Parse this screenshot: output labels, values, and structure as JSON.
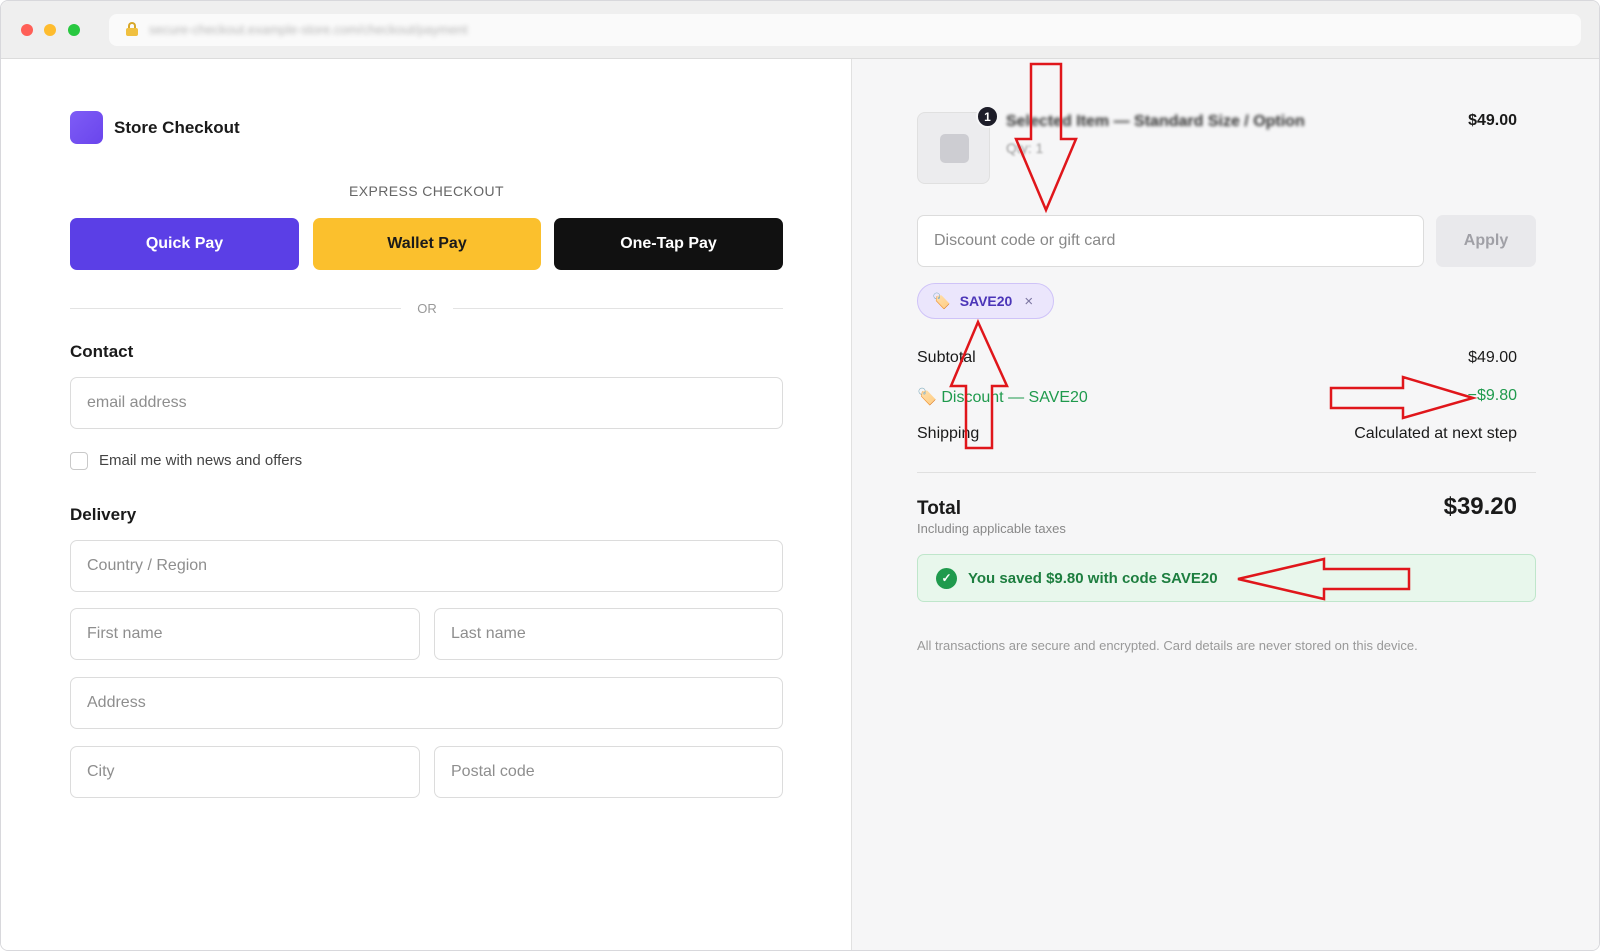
{
  "browser": {
    "url": "secure-checkout.example-store.com/checkout/payment"
  },
  "brand": {
    "name": "Store Checkout"
  },
  "express": {
    "label": "EXPRESS CHECKOUT",
    "buttons": [
      {
        "label": "Quick Pay",
        "color": "#5b3fe6"
      },
      {
        "label": "Wallet Pay",
        "color": "#fbc02d"
      },
      {
        "label": "One-Tap Pay",
        "color": "#111111"
      }
    ],
    "or_text": "OR"
  },
  "contact": {
    "title": "Contact",
    "email_placeholder": "email address",
    "newsletter_label": "Email me with news and offers",
    "newsletter_checked": false
  },
  "delivery": {
    "title": "Delivery",
    "country_placeholder": "Country / Region",
    "first_name_placeholder": "First name",
    "last_name_placeholder": "Last name",
    "address_placeholder": "Address",
    "city_placeholder": "City",
    "postal_placeholder": "Postal code"
  },
  "order": {
    "item": {
      "name": "Selected Item — Standard Size / Option",
      "qty_text": "Qty: 1",
      "qty_badge": "1",
      "price": "$49.00"
    },
    "discount_placeholder": "Discount code or gift card",
    "apply_label": "Apply",
    "applied_code": "SAVE20",
    "remove_symbol": "×",
    "tag_icon": "🏷️",
    "subtotal_label": "Subtotal",
    "subtotal_value": "$49.00",
    "discount_label": "Discount — SAVE20",
    "discount_value": "−$9.80",
    "shipping_label": "Shipping",
    "shipping_value": "Calculated at next step",
    "total_label": "Total",
    "total_sub": "Including applicable taxes",
    "total_value": "$39.20",
    "saved_text": "You saved $9.80 with code SAVE20",
    "saved_check": "✓",
    "footer_note": "All transactions are secure and encrypted. Card details are never stored on this device."
  },
  "colors": {
    "accent": "#5b3fe6",
    "success": "#1f9a4d",
    "annotation": "#e0161b"
  }
}
